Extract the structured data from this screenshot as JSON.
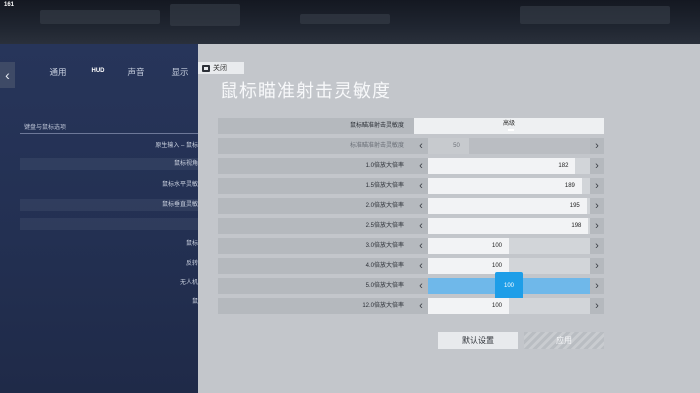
{
  "fps": "161",
  "left_panel": {
    "back_icon": "chevron-left-icon",
    "tabs": [
      "通用",
      "HUD",
      "声音",
      "显示"
    ],
    "section": "键盘与鼠标选项",
    "rows": [
      "原生输入 – 鼠标",
      "鼠标视角",
      "鼠标水平灵敏",
      "鼠标垂直灵敏",
      "",
      "鼠标",
      "反转",
      "无人机",
      "鼠"
    ]
  },
  "dialog": {
    "close_label": "关闭",
    "title": "鼠标瞄准射击灵敏度",
    "rows": [
      {
        "label": "鼠标瞄准射击灵敏度",
        "type": "select",
        "value": "高级"
      },
      {
        "label": "标准瞄准射击灵敏度",
        "type": "slider",
        "value": "50",
        "level": 0.25,
        "dim": true
      },
      {
        "label": "1.0倍放大倍率",
        "type": "slider",
        "value": "182",
        "level": 0.91
      },
      {
        "label": "1.5倍放大倍率",
        "type": "slider",
        "value": "189",
        "level": 0.95
      },
      {
        "label": "2.0倍放大倍率",
        "type": "slider",
        "value": "195",
        "level": 0.98
      },
      {
        "label": "2.5倍放大倍率",
        "type": "slider",
        "value": "198",
        "level": 0.99
      },
      {
        "label": "3.0倍放大倍率",
        "type": "slider",
        "value": "100",
        "level": 0.5
      },
      {
        "label": "4.0倍放大倍率",
        "type": "slider",
        "value": "100",
        "level": 0.5
      },
      {
        "label": "5.0倍放大倍率",
        "type": "slider",
        "value": "100",
        "level": 0.5,
        "active": true
      },
      {
        "label": "12.0倍放大倍率",
        "type": "slider",
        "value": "100",
        "level": 0.5
      }
    ],
    "default_button": "默认设置",
    "apply_button": "应用"
  },
  "colors": {
    "accent": "#1e9ee8",
    "panel": "#233052",
    "dialog": "#c3c6cb"
  }
}
